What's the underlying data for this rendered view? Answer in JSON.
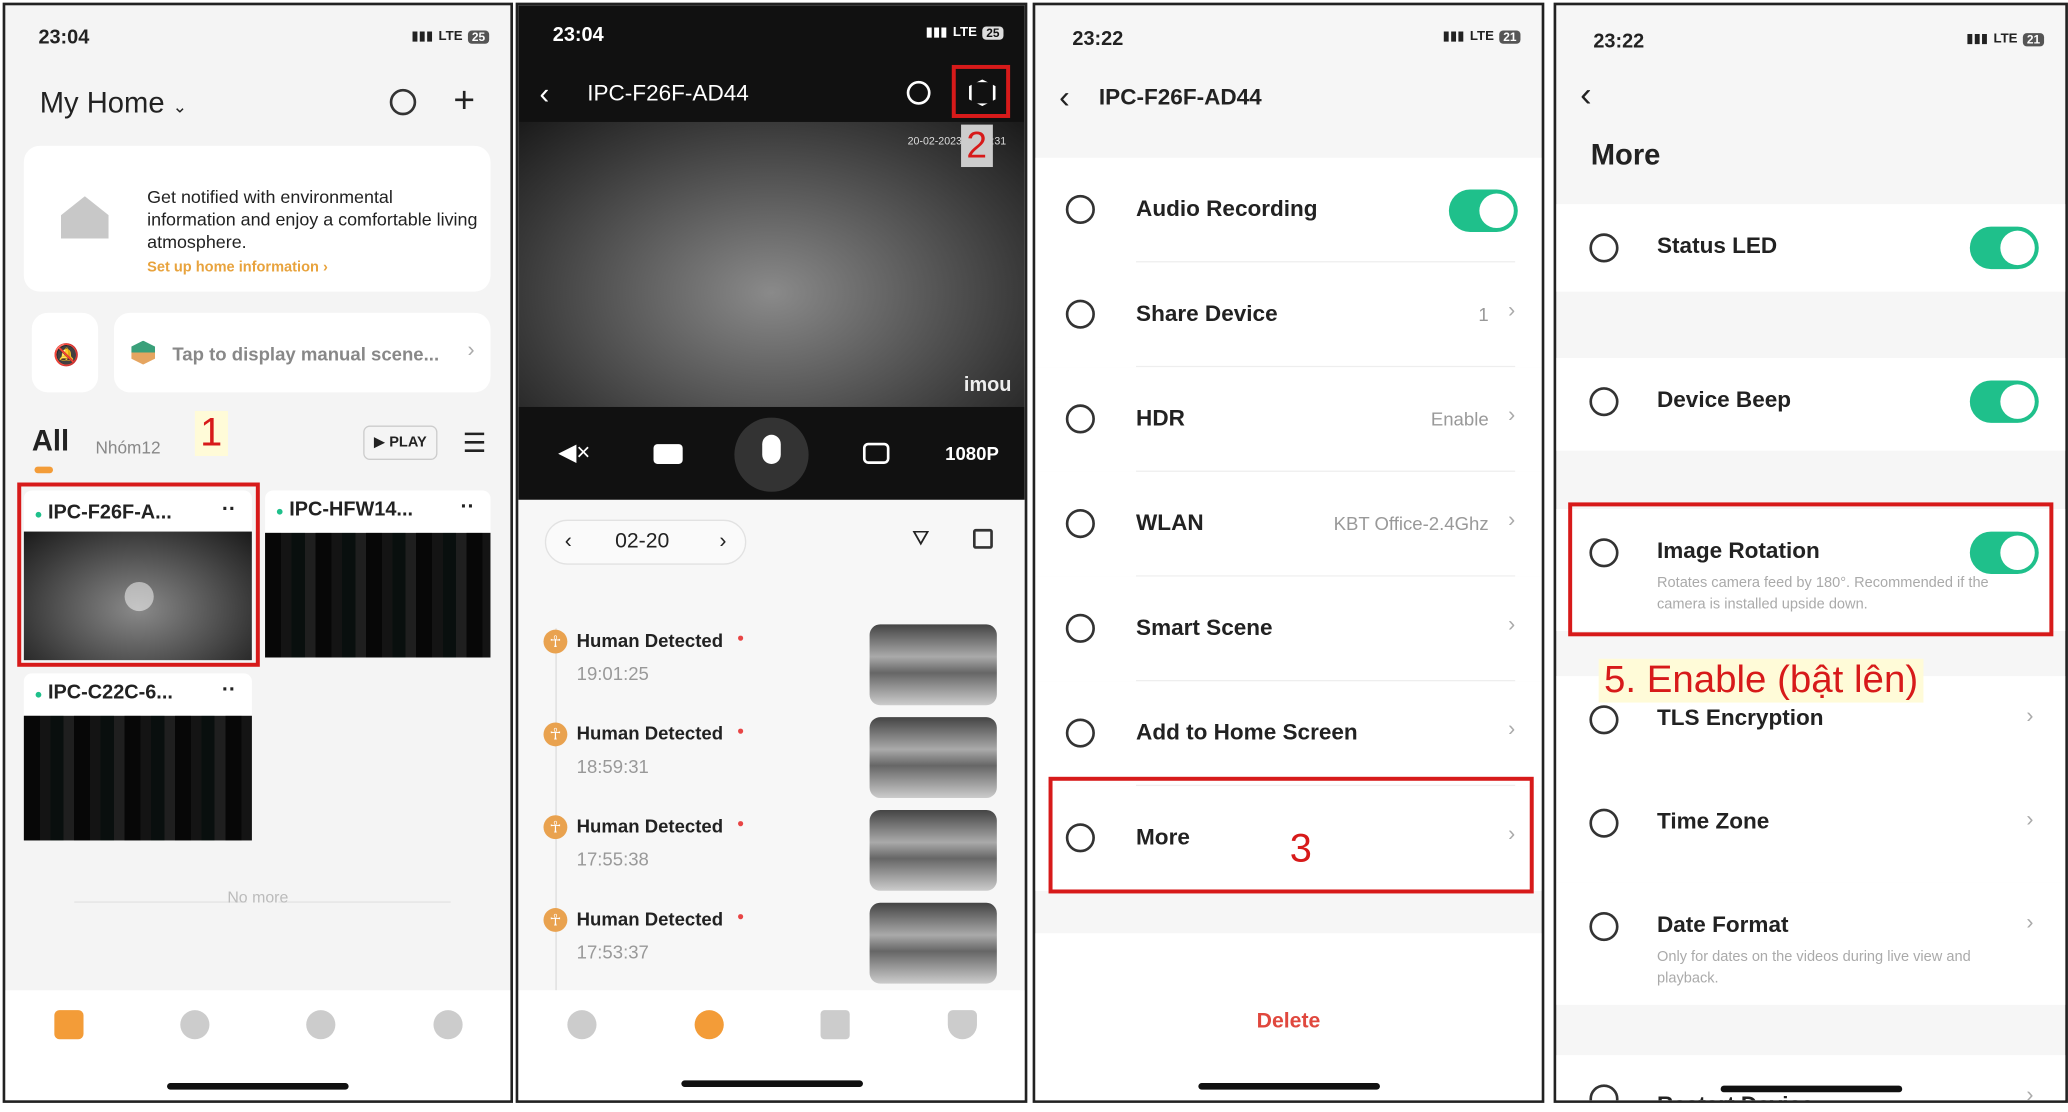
{
  "panel1": {
    "time": "23:04",
    "network": "LTE",
    "battery": "25",
    "title": "My Home",
    "card_text": "Get notified with environmental information and enjoy a comfortable living atmosphere.",
    "card_link": "Set up home information",
    "scene_text": "Tap to display manual scene...",
    "tab_all": "All",
    "tab_group": "Nhóm12",
    "annotation": "1",
    "play_label": "PLAY",
    "devices": [
      {
        "name": "IPC-F26F-A...",
        "online": true
      },
      {
        "name": "IPC-HFW14...",
        "online": true
      },
      {
        "name": "IPC-C22C-6...",
        "online": true
      }
    ],
    "no_more": "No more",
    "accent": "#f39c38"
  },
  "panel2": {
    "time": "23:04",
    "network": "LTE",
    "battery": "25",
    "title": "IPC-F26F-AD44",
    "annotation": "2",
    "timestamp": "20-02-2023 23:04:31",
    "brand": "imou",
    "resolution": "1080P",
    "date": "02-20",
    "events": [
      {
        "label": "Human Detected",
        "time": "19:01:25"
      },
      {
        "label": "Human Detected",
        "time": "18:59:31"
      },
      {
        "label": "Human Detected",
        "time": "17:55:38"
      },
      {
        "label": "Human Detected",
        "time": "17:53:37"
      }
    ]
  },
  "panel3": {
    "time": "23:22",
    "network": "LTE",
    "battery": "21",
    "title": "IPC-F26F-AD44",
    "rows": [
      {
        "label": "Audio Recording",
        "toggle": true
      },
      {
        "label": "Share Device",
        "value": "1"
      },
      {
        "label": "HDR",
        "value": "Enable"
      },
      {
        "label": "WLAN",
        "value": "KBT Office-2.4Ghz"
      },
      {
        "label": "Smart Scene"
      },
      {
        "label": "Add to Home Screen"
      },
      {
        "label": "More"
      }
    ],
    "annotation": "3",
    "delete_label": "Delete"
  },
  "panel4": {
    "time": "23:22",
    "network": "LTE",
    "battery": "21",
    "title": "More",
    "rows": [
      {
        "label": "Status LED",
        "toggle": true
      },
      {
        "label": "Device Beep",
        "toggle": true
      },
      {
        "label": "Image Rotation",
        "toggle": true,
        "desc": "Rotates camera feed by 180°. Recommended if the camera is installed upside down."
      },
      {
        "label": "TLS Encryption"
      },
      {
        "label": "Time Zone"
      },
      {
        "label": "Date Format",
        "desc": "Only for dates on the videos during live view and playback."
      },
      {
        "label": "Restart Device"
      }
    ],
    "annotation": "5. Enable (bật lên)",
    "toggle_color": "#1fc08b"
  }
}
